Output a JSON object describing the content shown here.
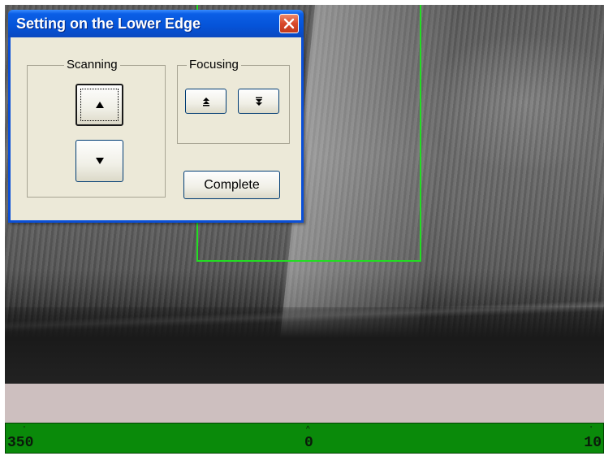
{
  "dialog": {
    "title": "Setting on the Lower Edge",
    "scanning_label": "Scanning",
    "focusing_label": "Focusing",
    "complete_label": "Complete"
  },
  "scale": {
    "left_label": "350",
    "center_label": "0",
    "right_label": "10"
  },
  "colors": {
    "roi_box": "#22dd22",
    "scale_bar": "#0a8a0a",
    "title_bar": "#0553d8",
    "dialog_bg": "#ece9d8",
    "status_bar": "#cdbfbf"
  },
  "icons": {
    "close": "close-icon",
    "scan_up": "triangle-up-icon",
    "scan_down": "triangle-down-icon",
    "focus_up": "double-arrow-up-icon",
    "focus_down": "double-arrow-down-icon"
  }
}
